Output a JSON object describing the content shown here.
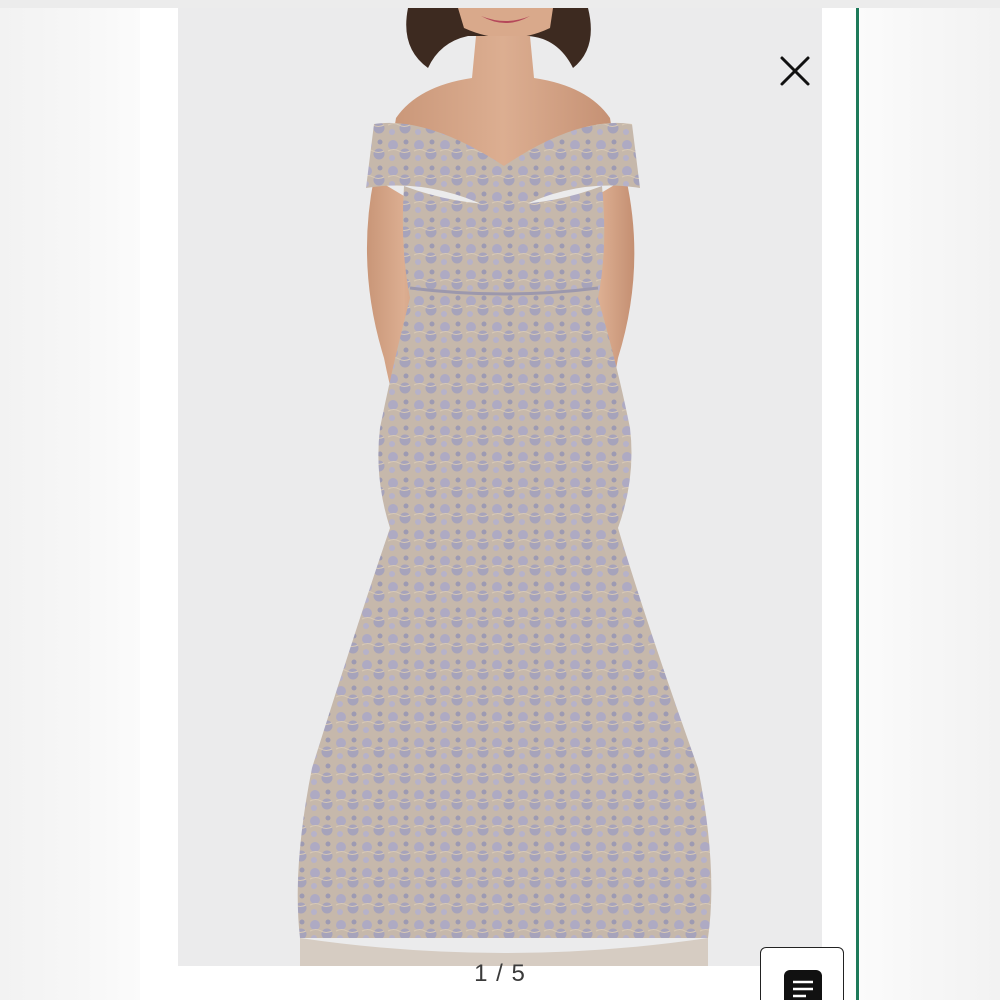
{
  "viewer": {
    "counter": "1 / 5",
    "close_icon": "close-icon",
    "menu_icon": "description-list-icon"
  },
  "photo": {
    "subject": "image",
    "colors": {
      "background": "#ebebec",
      "dress_lace": "#a9a6bd",
      "dress_base": "#c8b8a6",
      "skin": "#d6a98c",
      "hair": "#3d2a20",
      "accent": "#1e7a5a"
    }
  }
}
